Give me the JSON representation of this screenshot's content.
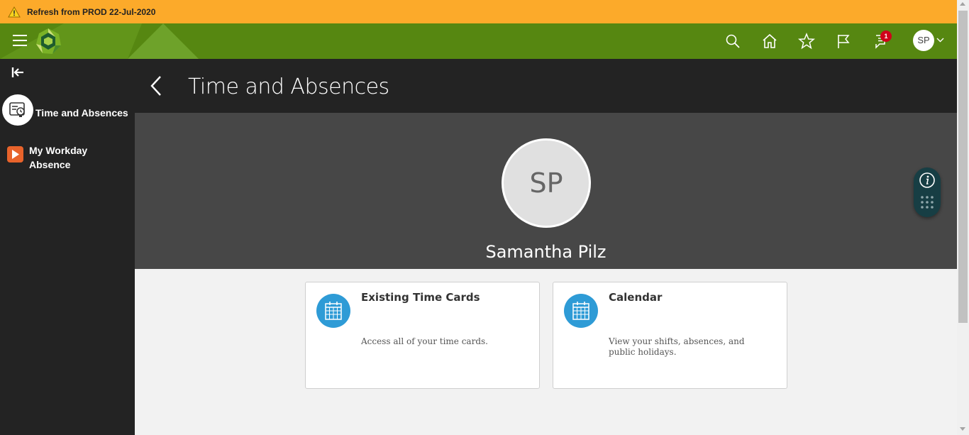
{
  "banner": {
    "text": "Refresh from PROD 22-Jul-2020",
    "color": "#fcaa2a"
  },
  "header": {
    "brand_color": "#568711",
    "icons": [
      "menu-icon",
      "search-icon",
      "home-icon",
      "star-icon",
      "flag-icon",
      "notification-icon",
      "chevron-down-icon"
    ],
    "notification_count": "1",
    "user_initials": "SP"
  },
  "sidebar": {
    "items": [
      {
        "label": "Time and Absences",
        "icon": "time-absences-icon"
      },
      {
        "label": "My Workday Absence",
        "icon": "workday-icon"
      }
    ]
  },
  "page": {
    "title": "Time and Absences"
  },
  "profile": {
    "initials": "SP",
    "name": "Samantha Pilz"
  },
  "cards": [
    {
      "title": "Existing Time Cards",
      "description": "Access all of your time cards.",
      "icon": "calendar-icon"
    },
    {
      "title": "Calendar",
      "description": "View your shifts, absences, and public holidays.",
      "icon": "calendar-icon"
    }
  ],
  "colors": {
    "accent_blue": "#2e9bd6",
    "dark_panel": "#232323",
    "band": "#474747"
  }
}
